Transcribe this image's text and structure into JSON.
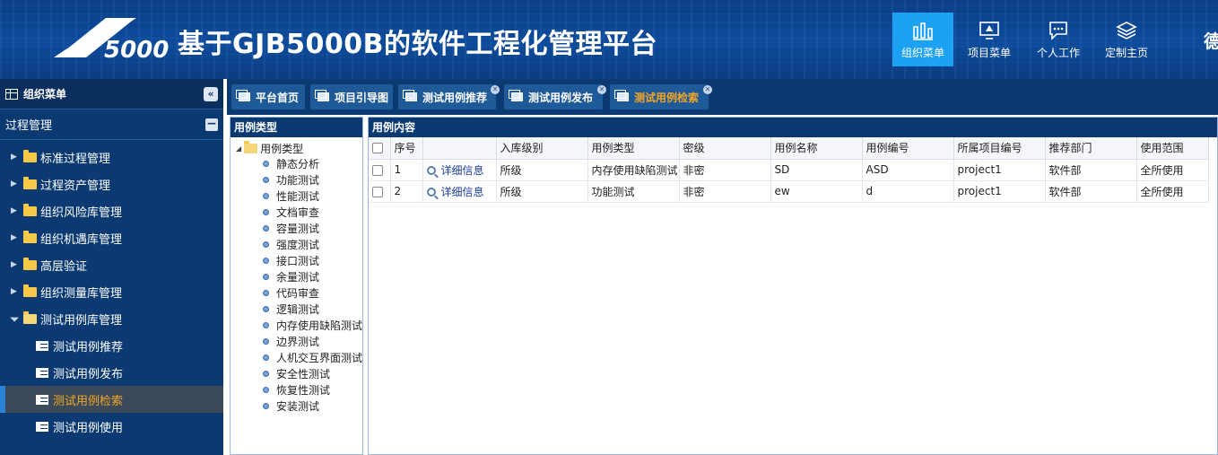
{
  "header": {
    "logo_text": "5000",
    "title": "基于GJB5000B的软件工程化管理平台",
    "nav": [
      {
        "label": "组织菜单",
        "icon": "bar-chart-icon",
        "active": true
      },
      {
        "label": "项目菜单",
        "icon": "monitor-icon",
        "active": false
      },
      {
        "label": "个人工作",
        "icon": "chat-icon",
        "active": false
      },
      {
        "label": "定制主页",
        "icon": "layers-icon",
        "active": false
      }
    ],
    "edge_glyph": "德"
  },
  "sidebar": {
    "title": "组织菜单",
    "collapse_glyph": "«",
    "group": "过程管理",
    "group_toggle": "−",
    "items": [
      {
        "label": "标准过程管理",
        "expanded": false
      },
      {
        "label": "过程资产管理",
        "expanded": false
      },
      {
        "label": "组织风险库管理",
        "expanded": false
      },
      {
        "label": "组织机遇库管理",
        "expanded": false
      },
      {
        "label": "高层验证",
        "expanded": false
      },
      {
        "label": "组织测量库管理",
        "expanded": false
      },
      {
        "label": "测试用例库管理",
        "expanded": true
      }
    ],
    "subitems": [
      {
        "label": "测试用例推荐",
        "active": false
      },
      {
        "label": "测试用例发布",
        "active": false
      },
      {
        "label": "测试用例检索",
        "active": true
      },
      {
        "label": "测试用例使用",
        "active": false
      }
    ]
  },
  "tabs": [
    {
      "label": "平台首页",
      "closable": false,
      "active": false
    },
    {
      "label": "项目引导图",
      "closable": false,
      "active": false
    },
    {
      "label": "测试用例推荐",
      "closable": true,
      "active": false
    },
    {
      "label": "测试用例发布",
      "closable": true,
      "active": false
    },
    {
      "label": "测试用例检索",
      "closable": true,
      "active": true
    }
  ],
  "left_panel": {
    "title": "用例类型",
    "root": "用例类型",
    "nodes": [
      "静态分析",
      "功能测试",
      "性能测试",
      "文档审查",
      "容量测试",
      "强度测试",
      "接口测试",
      "余量测试",
      "代码审查",
      "逻辑测试",
      "内存使用缺陷测试",
      "边界测试",
      "人机交互界面测试",
      "安全性测试",
      "恢复性测试",
      "安装测试"
    ]
  },
  "right_panel": {
    "title": "用例内容",
    "columns": [
      "序号",
      "",
      "入库级别",
      "用例类型",
      "密级",
      "用例名称",
      "用例编号",
      "所属项目编号",
      "推荐部门",
      "使用范围"
    ],
    "rows": [
      {
        "no": "1",
        "detail": "详细信息",
        "level": "所级",
        "type": "内存使用缺陷测试",
        "secret": "非密",
        "name": "SD",
        "code": "ASD",
        "project": "project1",
        "dept": "软件部",
        "scope": "全所使用"
      },
      {
        "no": "2",
        "detail": "详细信息",
        "level": "所级",
        "type": "功能测试",
        "secret": "非密",
        "name": "ew",
        "code": "d",
        "project": "project1",
        "dept": "软件部",
        "scope": "全所使用"
      }
    ]
  }
}
